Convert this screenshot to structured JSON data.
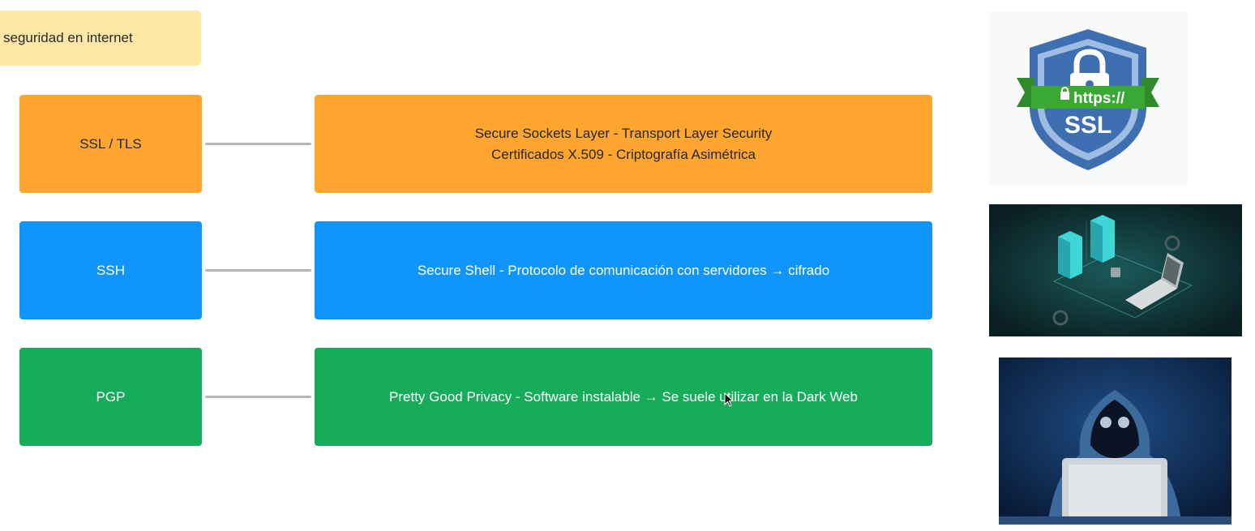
{
  "note": {
    "text": "seguridad en internet"
  },
  "rows": [
    {
      "label": "SSL / TLS",
      "line1": "Secure Sockets Layer - Transport Layer Security",
      "line2": "Certificados X.509 - Criptografía Asimétrica",
      "color": "#ffa630"
    },
    {
      "label": "SSH",
      "line1": "Secure Shell - Protocolo de comunicación con servidores → cifrado",
      "color": "#0f95fb"
    },
    {
      "label": "PGP",
      "line1": "Pretty Good Privacy - Software instalable → Se suele utilizar en la Dark Web",
      "color": "#16ac5a"
    }
  ],
  "images": {
    "ssl_badge": {
      "ribbon_text": "https://",
      "shield_text": "SSL",
      "icon": "lock-icon"
    },
    "server": {
      "icon": "server-laptop-illustration"
    },
    "hacker": {
      "icon": "hooded-hacker-illustration"
    }
  }
}
